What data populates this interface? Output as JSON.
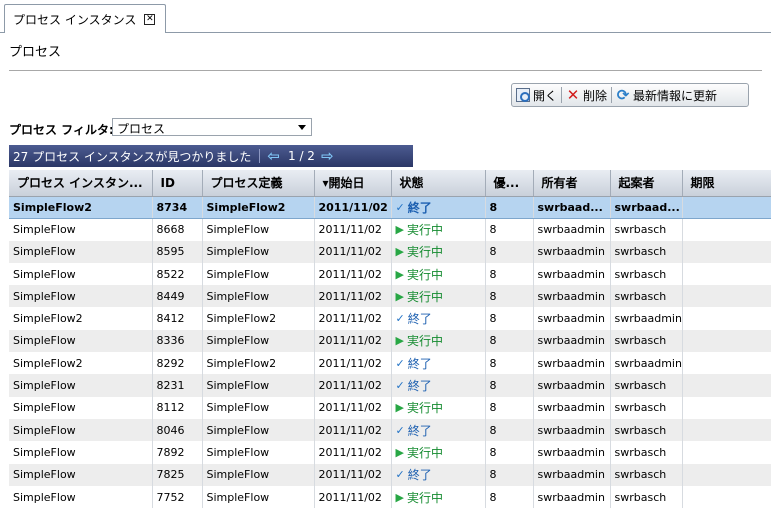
{
  "tab": {
    "label": "プロセス インスタンス",
    "close_glyph": "✕"
  },
  "page": {
    "title": "プロセス"
  },
  "toolbar": {
    "open_label": "開く",
    "delete_label": "削除",
    "refresh_label": "最新情報に更新"
  },
  "filter": {
    "label": "プロセス フィルタ:",
    "selected": "プロセス"
  },
  "results": {
    "summary": "27 プロセス インスタンスが見つかりました",
    "page_indicator": "1 / 2"
  },
  "table": {
    "columns": [
      "プロセス インスタン...",
      "ID",
      "プロセス定義",
      "▾開始日",
      "状態",
      "優...",
      "所有者",
      "起案者",
      "期限"
    ],
    "rows": [
      {
        "instance": "SimpleFlow2",
        "id": "8734",
        "definition": "SimpleFlow2",
        "start": "2011/11/02",
        "status": "終了",
        "status_type": "done",
        "priority": "8",
        "owner": "swrbaad...",
        "drafter": "swrbaad...",
        "due": ""
      },
      {
        "instance": "SimpleFlow",
        "id": "8668",
        "definition": "SimpleFlow",
        "start": "2011/11/02",
        "status": "実行中",
        "status_type": "run",
        "priority": "8",
        "owner": "swrbaadmin",
        "drafter": "swrbasch",
        "due": ""
      },
      {
        "instance": "SimpleFlow",
        "id": "8595",
        "definition": "SimpleFlow",
        "start": "2011/11/02",
        "status": "実行中",
        "status_type": "run",
        "priority": "8",
        "owner": "swrbaadmin",
        "drafter": "swrbasch",
        "due": ""
      },
      {
        "instance": "SimpleFlow",
        "id": "8522",
        "definition": "SimpleFlow",
        "start": "2011/11/02",
        "status": "実行中",
        "status_type": "run",
        "priority": "8",
        "owner": "swrbaadmin",
        "drafter": "swrbasch",
        "due": ""
      },
      {
        "instance": "SimpleFlow",
        "id": "8449",
        "definition": "SimpleFlow",
        "start": "2011/11/02",
        "status": "実行中",
        "status_type": "run",
        "priority": "8",
        "owner": "swrbaadmin",
        "drafter": "swrbasch",
        "due": ""
      },
      {
        "instance": "SimpleFlow2",
        "id": "8412",
        "definition": "SimpleFlow2",
        "start": "2011/11/02",
        "status": "終了",
        "status_type": "done",
        "priority": "8",
        "owner": "swrbaadmin",
        "drafter": "swrbaadmin",
        "due": ""
      },
      {
        "instance": "SimpleFlow",
        "id": "8336",
        "definition": "SimpleFlow",
        "start": "2011/11/02",
        "status": "実行中",
        "status_type": "run",
        "priority": "8",
        "owner": "swrbaadmin",
        "drafter": "swrbasch",
        "due": ""
      },
      {
        "instance": "SimpleFlow2",
        "id": "8292",
        "definition": "SimpleFlow2",
        "start": "2011/11/02",
        "status": "終了",
        "status_type": "done",
        "priority": "8",
        "owner": "swrbaadmin",
        "drafter": "swrbaadmin",
        "due": ""
      },
      {
        "instance": "SimpleFlow",
        "id": "8231",
        "definition": "SimpleFlow",
        "start": "2011/11/02",
        "status": "終了",
        "status_type": "done",
        "priority": "8",
        "owner": "swrbaadmin",
        "drafter": "swrbasch",
        "due": ""
      },
      {
        "instance": "SimpleFlow",
        "id": "8112",
        "definition": "SimpleFlow",
        "start": "2011/11/02",
        "status": "実行中",
        "status_type": "run",
        "priority": "8",
        "owner": "swrbaadmin",
        "drafter": "swrbasch",
        "due": ""
      },
      {
        "instance": "SimpleFlow",
        "id": "8046",
        "definition": "SimpleFlow",
        "start": "2011/11/02",
        "status": "終了",
        "status_type": "done",
        "priority": "8",
        "owner": "swrbaadmin",
        "drafter": "swrbasch",
        "due": ""
      },
      {
        "instance": "SimpleFlow",
        "id": "7892",
        "definition": "SimpleFlow",
        "start": "2011/11/02",
        "status": "実行中",
        "status_type": "run",
        "priority": "8",
        "owner": "swrbaadmin",
        "drafter": "swrbasch",
        "due": ""
      },
      {
        "instance": "SimpleFlow",
        "id": "7825",
        "definition": "SimpleFlow",
        "start": "2011/11/02",
        "status": "終了",
        "status_type": "done",
        "priority": "8",
        "owner": "swrbaadmin",
        "drafter": "swrbasch",
        "due": ""
      },
      {
        "instance": "SimpleFlow",
        "id": "7752",
        "definition": "SimpleFlow",
        "start": "2011/11/02",
        "status": "実行中",
        "status_type": "run",
        "priority": "8",
        "owner": "swrbaadmin",
        "drafter": "swrbasch",
        "due": ""
      }
    ]
  }
}
